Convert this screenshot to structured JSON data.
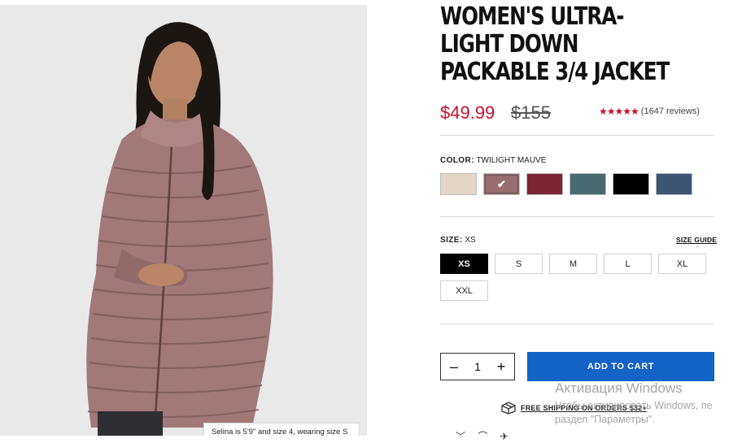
{
  "product": {
    "title": "WOMEN'S ULTRA-LIGHT DOWN PACKABLE 3/4 JACKET",
    "price": "$49.99",
    "old_price": "$155",
    "rating_stars": "★★★★★",
    "reviews": "(1647 reviews)",
    "image_caption": "Selina is 5'9\" and size 4, wearing size S"
  },
  "color": {
    "label": "COLOR:",
    "selected": "TWILIGHT MAUVE",
    "swatches": [
      "#e2d6c5",
      "#9a6e70",
      "#7a2633",
      "#4a6a72",
      "#000000",
      "#3e5576"
    ],
    "selected_index": 1
  },
  "size": {
    "label": "SIZE:",
    "selected": "XS",
    "guide_label": "SIZE GUIDE",
    "options": [
      "XS",
      "S",
      "M",
      "L",
      "XL",
      "XXL"
    ]
  },
  "quantity": {
    "minus": "–",
    "value": "1",
    "plus": "+"
  },
  "cart": {
    "label": "ADD TO CART"
  },
  "shipping": {
    "label": "FREE SHIPPING ON ORDERS $32+"
  },
  "watermark": {
    "line1": "Активация Windows",
    "line2": "Чтобы активировать Windows, пе",
    "line3": "раздел \"Параметры\"."
  },
  "bottom_glyphs": "﹀ ⌒ ✈"
}
